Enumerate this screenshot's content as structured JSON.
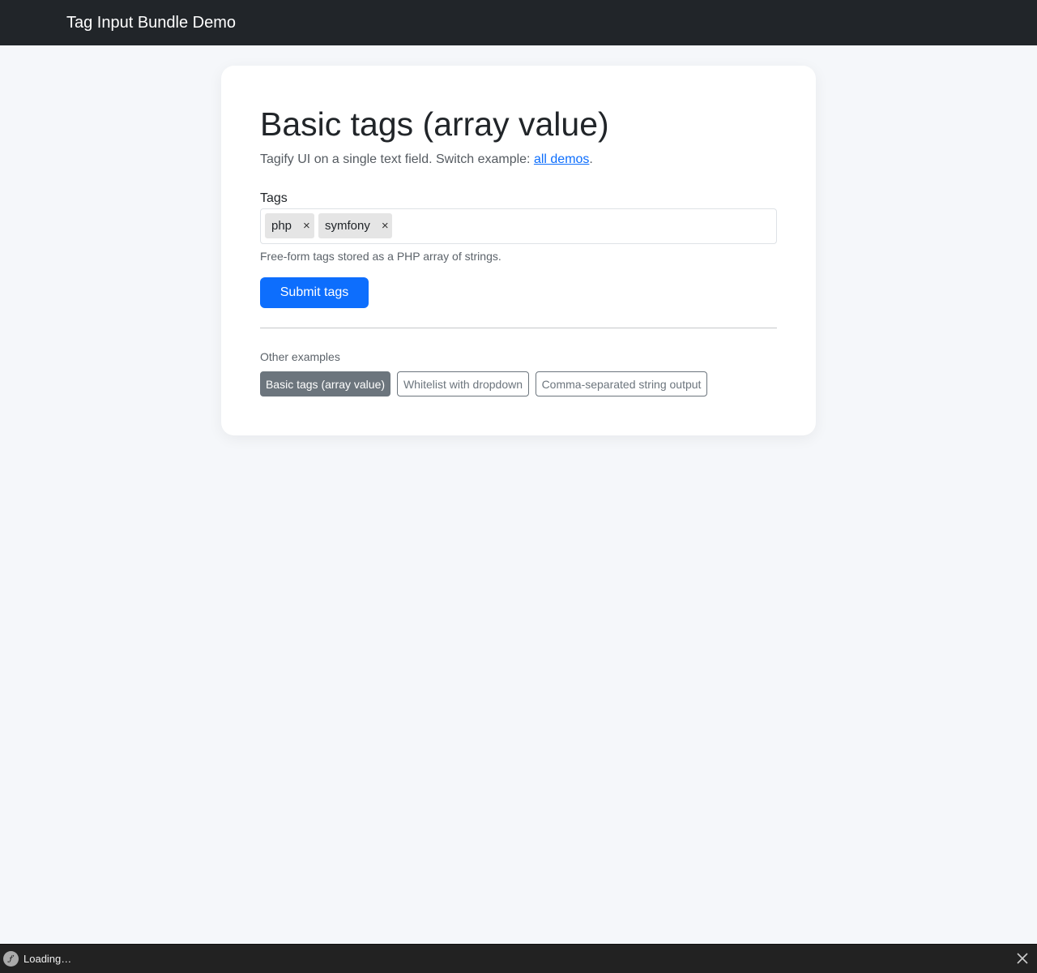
{
  "navbar": {
    "brand": "Tag Input Bundle Demo"
  },
  "main": {
    "title": "Basic tags (array value)",
    "lead_text": "Tagify UI on a single text field. Switch example: ",
    "lead_link": "all demos",
    "lead_suffix": ".",
    "field": {
      "label": "Tags",
      "tags": [
        {
          "label": "php",
          "remove": "×"
        },
        {
          "label": "symfony",
          "remove": "×"
        }
      ],
      "placeholder": "",
      "help": "Free-form tags stored as a PHP array of strings."
    },
    "submit_label": "Submit tags",
    "other_examples": {
      "label": "Other examples",
      "items": [
        {
          "label": "Basic tags (array value)",
          "active": true
        },
        {
          "label": "Whitelist with dropdown",
          "active": false
        },
        {
          "label": "Comma-separated string output",
          "active": false
        }
      ]
    }
  },
  "toolbar": {
    "status": "Loading…",
    "logo_icon": "symfony-icon",
    "close_icon": "close-icon"
  },
  "colors": {
    "primary": "#0d6efd",
    "secondary": "#6c757d",
    "navbar_bg": "#212529",
    "page_bg": "#f5f7fa",
    "tag_bg": "#e5e5e5"
  }
}
